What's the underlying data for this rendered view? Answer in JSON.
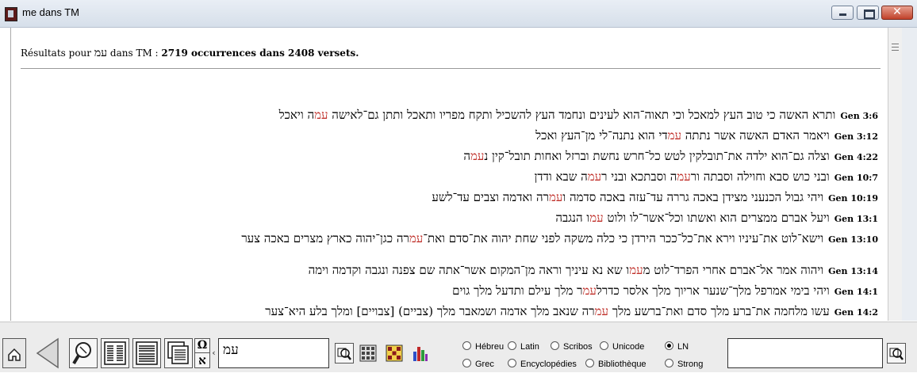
{
  "window": {
    "title": "me dans TM"
  },
  "results": {
    "prefix": "Résultats pour",
    "term": "עמ",
    "middle": "dans TM :",
    "summary": "2719 occurrences dans 2408 versets."
  },
  "verses": [
    {
      "ref": "Gen 3:6",
      "parts": [
        "ותרא האשה כי טוב העץ למאכל וכי תאוה־הוא לעינים ונחמד העץ להשכיל ותקח מפריו ותאכל ותתן גם־לאישה ",
        "עמ",
        "ה ויאכל"
      ]
    },
    {
      "ref": "Gen 3:12",
      "parts": [
        "ויאמר האדם האשה אשר נתתה ",
        "עמ",
        "די הוא נתנה־לי מן־העץ ואכל"
      ]
    },
    {
      "ref": "Gen 4:22",
      "parts": [
        "וצלה גם־הוא ילדה את־תובלקין לטש כל־חרש נחשת וברזל ואחות תובל־קין נ",
        "עמ",
        "ה"
      ]
    },
    {
      "ref": "Gen 10:7",
      "parts": [
        "ובני כוש סבא וחוילה וסבתה ור",
        "עמ",
        "ה וסבתכא ובני ר",
        "עמ",
        "ה שבא ודדן"
      ]
    },
    {
      "ref": "Gen 10:19",
      "parts": [
        "ויהי גבול הכנעני מצידן באכה גררה עד־עזה באכה סדמה ו",
        "עמ",
        "רה ואדמה וצבים עד־לשע"
      ]
    },
    {
      "ref": "Gen 13:1",
      "parts": [
        "ויעל אברם ממצרים הוא ואשתו וכל־אשר־לו ולוט ",
        "עמ",
        "ו הנגבה"
      ]
    },
    {
      "ref": "Gen 13:10",
      "parts": [
        "וישא־לוט את־עיניו וירא את־כל־ככר הירדן כי כלה משקה לפני שחת יהוה את־סדם ואת־",
        "עמ",
        "רה כגן־יהוה כארץ מצרים באכה צער"
      ]
    },
    {
      "ref": "Gen 13:14",
      "parts": [
        "ויהוה אמר אל־אברם אחרי הפרד־לוט מ",
        "עמ",
        "ו שא נא עיניך וראה מן־המקום אשר־אתה שם צפנה ונגבה וקדמה וימה"
      ]
    },
    {
      "ref": "Gen 14:1",
      "parts": [
        "ויהי בימי אמרפל מלך־שנער אריוך מלך אלסר כדרל",
        "עמ",
        "ר מלך עילם ותדעל מלך גוים"
      ]
    },
    {
      "ref": "Gen 14:2",
      "parts": [
        "עשו מלחמה את־ברע מלך סדם ואת־ברשע מלך ",
        "עמ",
        "רה שנאב מלך אדמה ושמאבר מלך (צביים) [צבויים] ומלך בלע היא־צער"
      ]
    }
  ],
  "toolbar": {
    "search_value": "עמ",
    "search2_value": "",
    "omega_glyph": "Ω",
    "aleph_glyph": "א",
    "chevron_glyph": "‹",
    "radios_row1": [
      {
        "label": "Hébreu",
        "checked": false
      },
      {
        "label": "Latin",
        "checked": false
      },
      {
        "label": "Scribos",
        "checked": false
      },
      {
        "label": "Unicode",
        "checked": false
      },
      {
        "label": "LN",
        "checked": true
      }
    ],
    "radios_row2": [
      {
        "label": "Grec",
        "checked": false
      },
      {
        "label": "Encyclopédies",
        "checked": false
      },
      {
        "label": "Bibliothèque",
        "checked": false
      },
      {
        "label": "Strong",
        "checked": false
      }
    ]
  },
  "colors": {
    "highlight": "#c0302a",
    "titlebar": "#dce4ee"
  }
}
